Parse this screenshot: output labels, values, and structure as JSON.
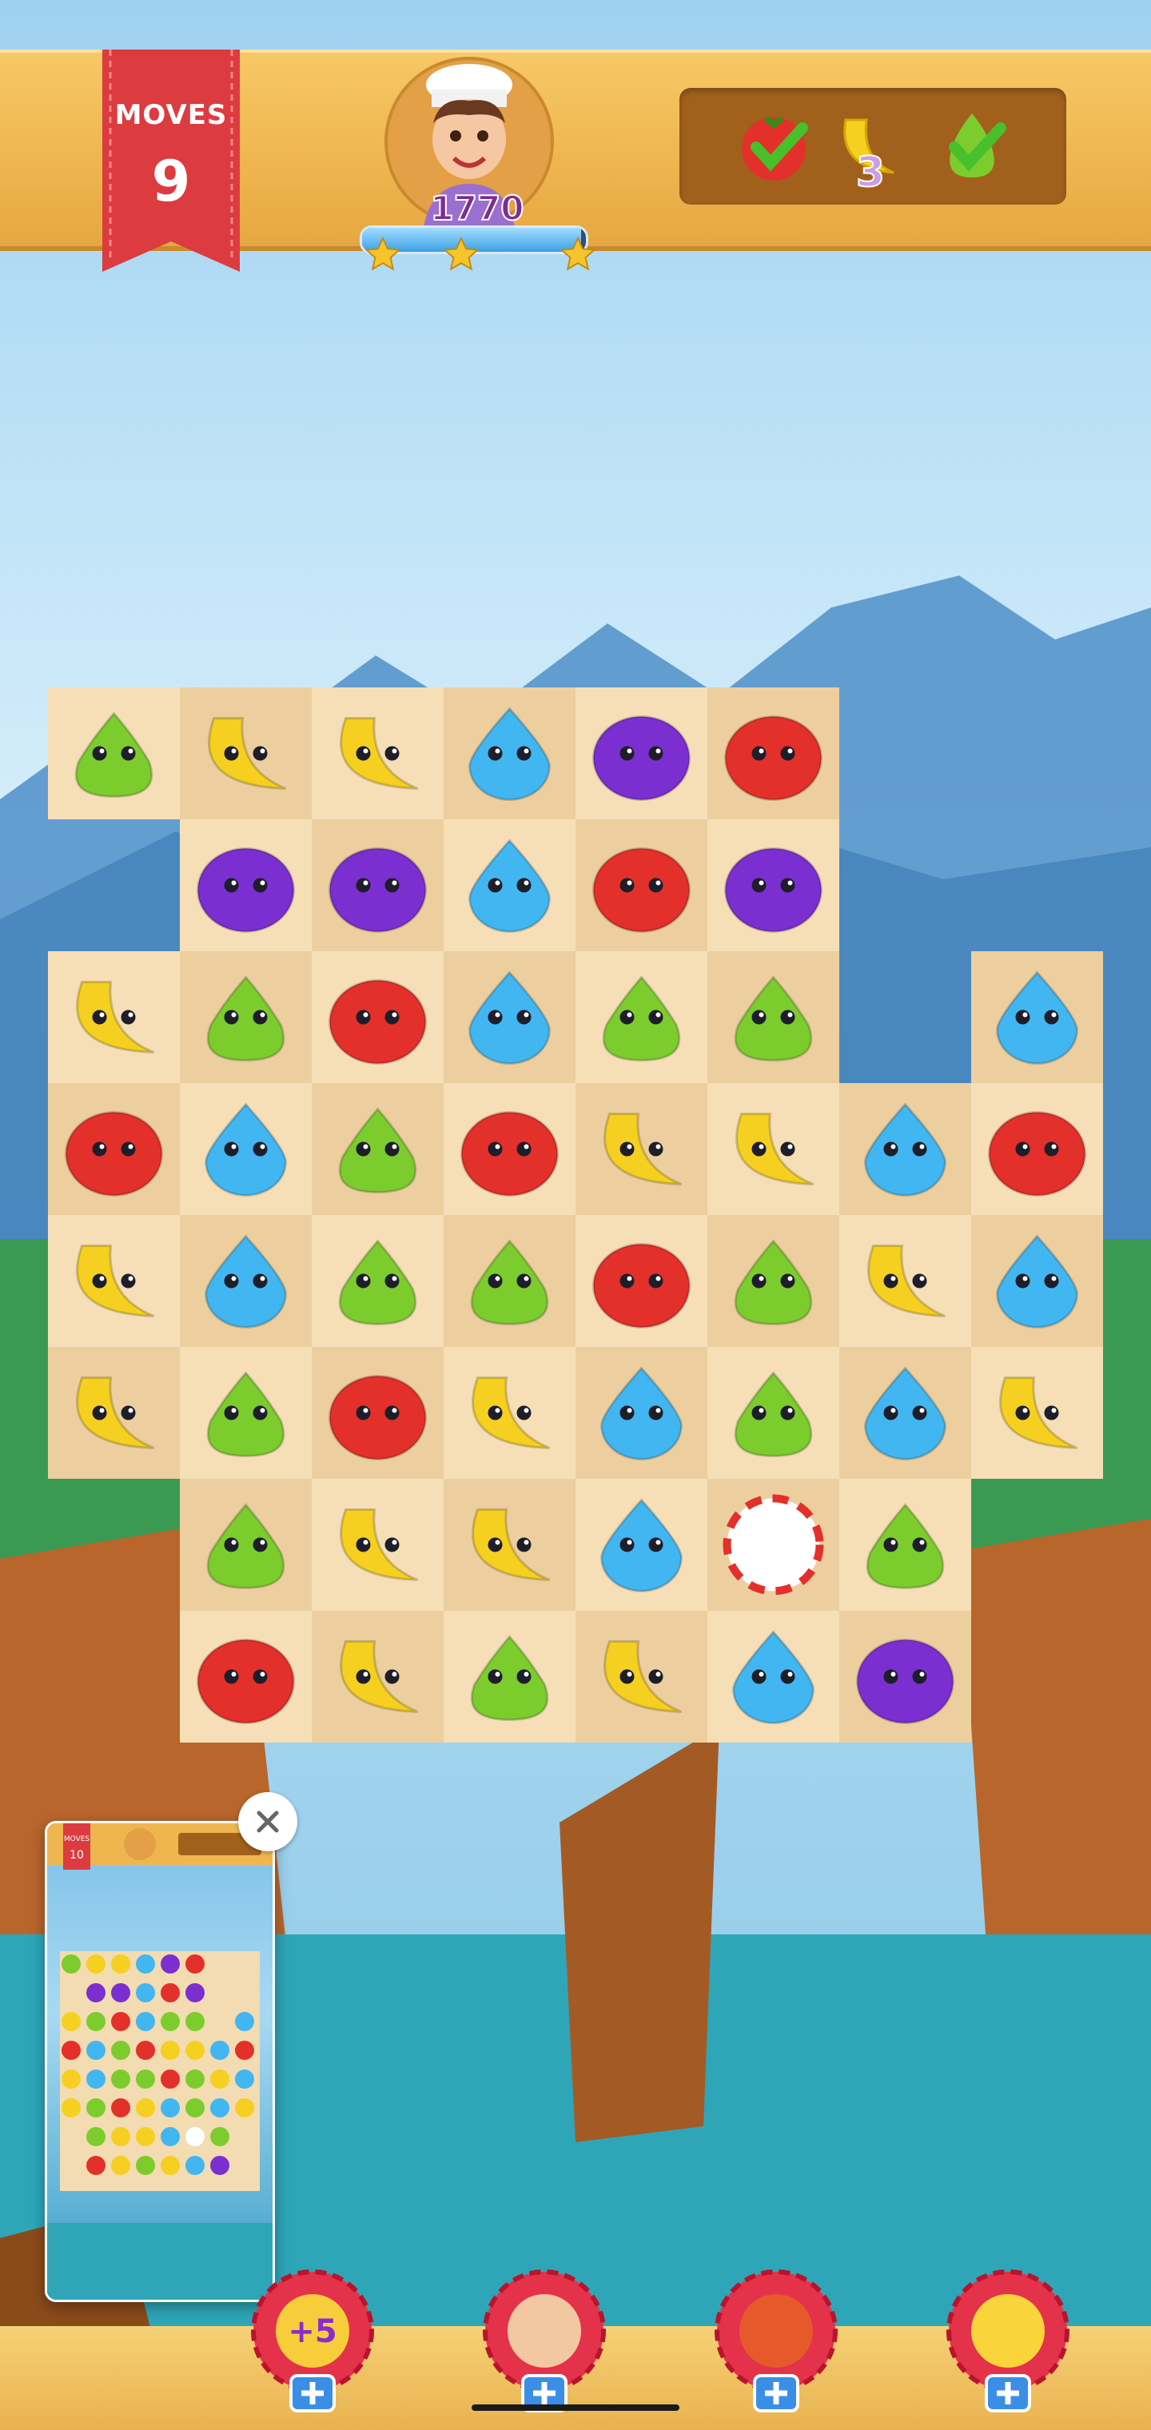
{
  "hud": {
    "moves_label": "MOVES",
    "moves_value": "9",
    "score": "1770",
    "progress_fraction": 0.98,
    "stars_earned": 3
  },
  "goals": [
    {
      "icon": "tomato-icon",
      "status": "complete"
    },
    {
      "icon": "banana-icon",
      "remaining": "3"
    },
    {
      "icon": "pear-icon",
      "status": "complete"
    }
  ],
  "board": {
    "rows": [
      [
        "pear",
        "banana",
        "banana",
        "drop",
        "grape",
        "tomato",
        null,
        null
      ],
      [
        null,
        "grape",
        "grape",
        "drop",
        "tomato",
        "grape",
        null,
        null
      ],
      [
        "banana",
        "pear",
        "tomato",
        "drop",
        "pear",
        "pear",
        null,
        "drop"
      ],
      [
        "tomato",
        "drop",
        "pear",
        "tomato",
        "banana",
        "banana",
        "drop",
        "tomato"
      ],
      [
        "banana",
        "drop",
        "pear",
        "pear",
        "tomato",
        "pear",
        "banana",
        "drop"
      ],
      [
        "banana",
        "pear",
        "tomato",
        "banana",
        "drop",
        "pear",
        "drop",
        "banana"
      ],
      [
        null,
        "pear",
        "banana",
        "banana",
        "drop",
        "candy",
        "pear",
        null
      ],
      [
        null,
        "tomato",
        "banana",
        "pear",
        "banana",
        "drop",
        "grape",
        null
      ]
    ]
  },
  "pip": {
    "moves_label": "MOVES",
    "moves_value": "10"
  },
  "boosters": [
    {
      "name": "extra-moves",
      "label": "+5"
    },
    {
      "name": "hand",
      "label": ""
    },
    {
      "name": "bomb",
      "label": ""
    },
    {
      "name": "magic-wand",
      "label": ""
    }
  ],
  "colors": {
    "tomato": "#e3302a",
    "banana": "#f5d020",
    "pear": "#7ccc2e",
    "drop": "#42b6f0",
    "grape": "#7b2fd0",
    "board_light": "#f6dfb7",
    "board_dark": "#edcf9f",
    "ribbon": "#dc3b3f"
  }
}
